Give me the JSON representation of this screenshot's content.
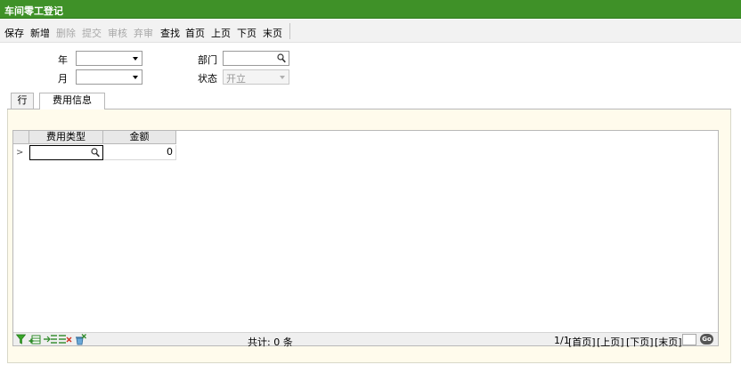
{
  "window": {
    "title": "车间零工登记"
  },
  "toolbar": {
    "save": "保存",
    "new": "新增",
    "delete": "删除",
    "submit": "提交",
    "audit": "审核",
    "abandon": "弃审",
    "find": "查找",
    "first": "首页",
    "prev": "上页",
    "next": "下页",
    "last": "末页"
  },
  "form": {
    "year_label": "年",
    "month_label": "月",
    "dept_label": "部门",
    "status_label": "状态",
    "status_value": "开立"
  },
  "tabs": [
    {
      "label": "行"
    },
    {
      "label": "费用信息"
    }
  ],
  "grid": {
    "columns": [
      "费用类型",
      "金额"
    ],
    "rows": [
      {
        "marker": ">",
        "type": "",
        "amount": "0"
      }
    ]
  },
  "footer": {
    "total": "共计: 0 条",
    "page_info": "1/1",
    "first": "[首页]",
    "prev": "[上页]",
    "next": "[下页]",
    "last": "[末页]",
    "go": "Go"
  }
}
